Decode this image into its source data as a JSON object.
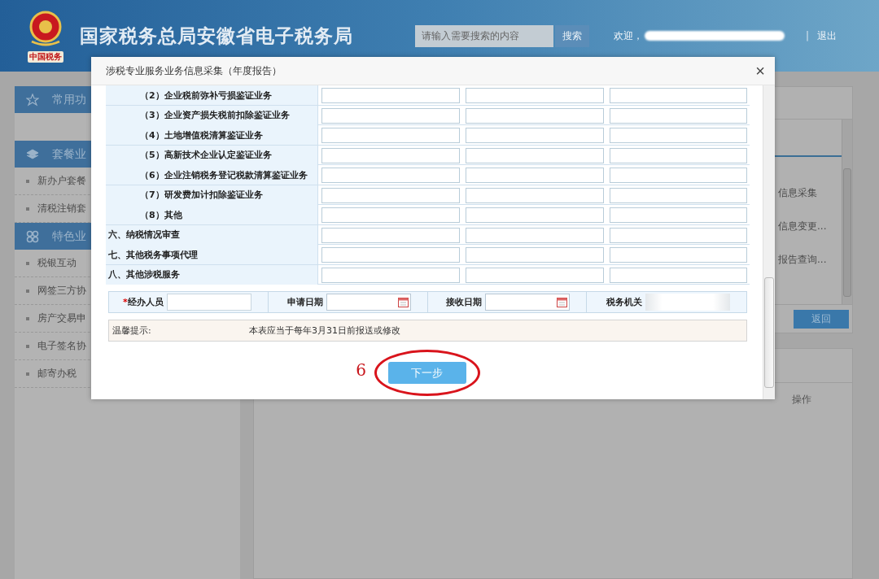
{
  "header": {
    "title": "国家税务总局安徽省电子税务局",
    "logo_caption": "中国税务",
    "search": {
      "placeholder": "请输入需要搜索的内容",
      "button": "搜索"
    },
    "welcome": "欢迎，",
    "separator": "|",
    "logout": "退出"
  },
  "sidebar": {
    "sections": [
      {
        "title": "常用功"
      },
      {
        "title": "套餐业",
        "items": [
          "新办户套餐",
          "清税注销套"
        ]
      },
      {
        "title": "特色业",
        "items": [
          "税银互动",
          "网签三方协",
          "房产交易申",
          "电子签名协",
          "邮寄办税"
        ]
      }
    ]
  },
  "right_panel": {
    "links": [
      "信息采集",
      "信息变更...",
      "报告查询..."
    ],
    "back_button": "返回",
    "table_columns": [
      "操作"
    ]
  },
  "modal": {
    "title": "涉税专业服务业务信息采集（年度报告）",
    "close": "×",
    "rows": [
      {
        "kind": "item",
        "label": "（2）企业税前弥补亏损鉴证业务"
      },
      {
        "kind": "item",
        "label": "（3）企业资产损失税前扣除鉴证业务"
      },
      {
        "kind": "item",
        "label": "（4）土地增值税清算鉴证业务"
      },
      {
        "kind": "item",
        "label": "（5）高新技术企业认定鉴证业务"
      },
      {
        "kind": "item",
        "label": "（6）企业注销税务登记税款清算鉴证业务"
      },
      {
        "kind": "item",
        "label": "（7）研发费加计扣除鉴证业务"
      },
      {
        "kind": "item",
        "label": "（8）其他"
      },
      {
        "kind": "category",
        "label": "六、纳税情况审查"
      },
      {
        "kind": "category",
        "label": "七、其他税务事项代理"
      },
      {
        "kind": "category",
        "label": "八、其他涉税服务"
      }
    ],
    "required_mark": "*",
    "fields": [
      {
        "kind": "text",
        "label": "经办人员",
        "required": true
      },
      {
        "kind": "date",
        "label": "申请日期",
        "required": false
      },
      {
        "kind": "date",
        "label": "接收日期",
        "required": false
      },
      {
        "kind": "redacted",
        "label": "税务机关",
        "required": false
      }
    ],
    "notice": {
      "label": "温馨提示:",
      "text": "本表应当于每年3月31日前报送或修改"
    },
    "step_number": "6",
    "next_button": {
      "label": "下一步",
      "highlighted": true
    }
  }
}
